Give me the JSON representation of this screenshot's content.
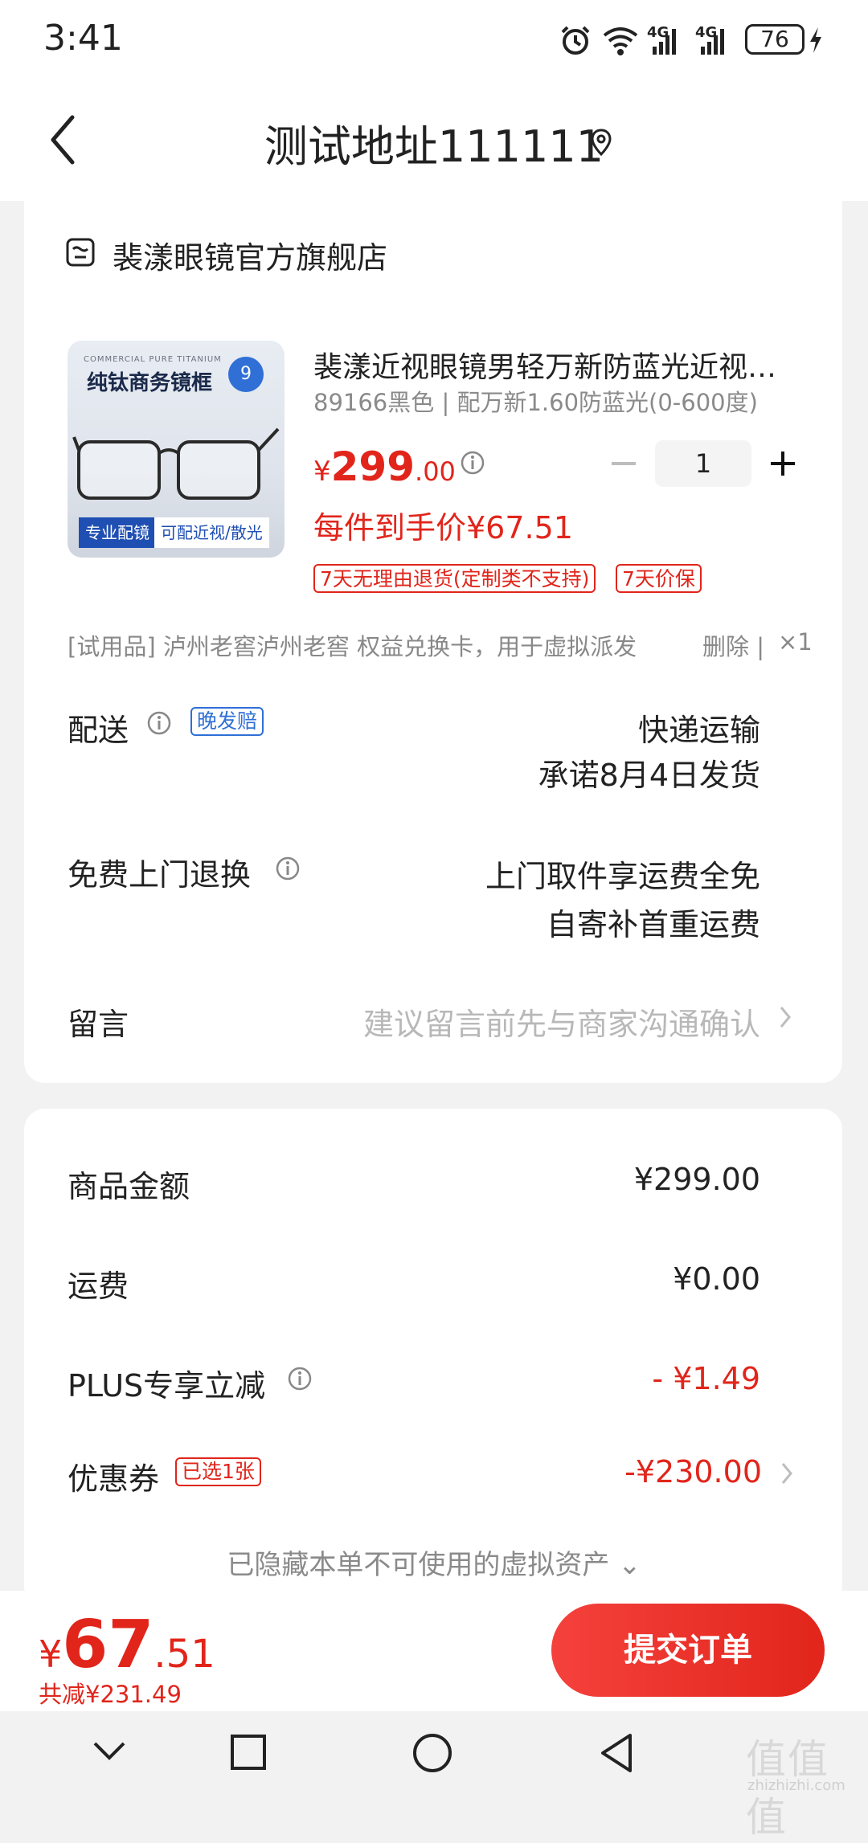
{
  "status_bar": {
    "time": "3:41",
    "battery": "76",
    "icons": [
      "alarm-icon",
      "wifi-icon",
      "signal-4g-icon",
      "signal-4g-icon",
      "battery-icon",
      "charging-icon"
    ],
    "network1": "4G",
    "network2": "4G"
  },
  "header": {
    "address": "测试地址111111",
    "icons": [
      "back-icon",
      "location-icon"
    ]
  },
  "shop": {
    "name": "裴漾眼镜官方旗舰店",
    "icon": "shop-icon"
  },
  "product": {
    "image_top_text": "COMMERCIAL PURE TITANIUM",
    "image_main_text": "纯钛商务镜框",
    "image_badge": "9",
    "image_tag_left": "专业配镜",
    "image_tag_right": "可配近视/散光",
    "title": "裴漾近视眼镜男轻万新防蓝光近视眼镜框",
    "spec": "89166黑色 | 配万新1.60防蓝光(0-600度)",
    "price_currency": "¥",
    "price_int": "299",
    "price_dec": ".00",
    "quantity": "1",
    "unit_price_text": "每件到手价¥67.51",
    "tags": [
      "7天无理由退货(定制类不支持)",
      "7天价保"
    ]
  },
  "gift": {
    "text": "[试用品]  泸州老窖泸州老窖  权益兑换卡，用于虚拟派发",
    "delete": "删除 |",
    "qty": "×1"
  },
  "delivery": {
    "label": "配送",
    "tag": "晚发赔",
    "value1": "快递运输",
    "value2": "承诺8月4日发货"
  },
  "returns": {
    "label": "免费上门退换",
    "value1": "上门取件享运费全免",
    "value2": "自寄补首重运费"
  },
  "message": {
    "label": "留言",
    "placeholder": "建议留言前先与商家沟通确认"
  },
  "summary": {
    "amount_label": "商品金额",
    "amount_value": "¥299.00",
    "shipping_label": "运费",
    "shipping_value": "¥0.00",
    "plus_label": "PLUS专享立减",
    "plus_value": "- ¥1.49",
    "coupon_label": "优惠券",
    "coupon_tag": "已选1张",
    "coupon_value": "-¥230.00",
    "hidden_assets": "已隐藏本单不可使用的虚拟资产 ⌄"
  },
  "bottom": {
    "currency": "¥",
    "total_int": "67",
    "total_dec": ".51",
    "saved": "共减¥231.49",
    "submit": "提交订单"
  },
  "watermark": {
    "main": "值值值",
    "sub": "zhizhizhi.com"
  },
  "colors": {
    "accent": "#e1251b",
    "info_blue": "#2f6fd6",
    "background": "#f2f2f2"
  }
}
